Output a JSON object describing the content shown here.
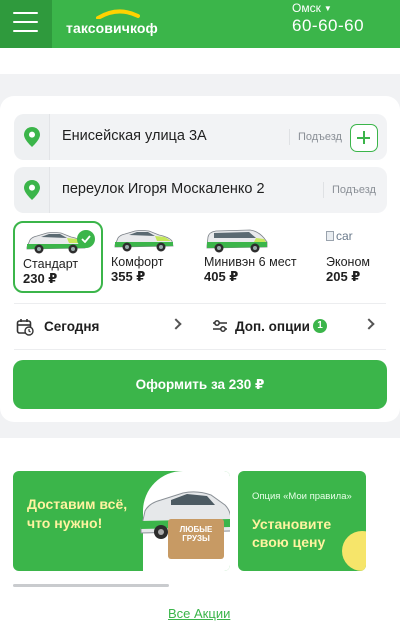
{
  "header": {
    "logo_text": "таксовичкоф",
    "city": "Омск",
    "phone": "60-60-60"
  },
  "route": {
    "from": {
      "address": "Енисейская улица 3А",
      "entrance_placeholder": "Подъезд"
    },
    "to": {
      "address": "переулок Игоря Москаленко 2",
      "entrance_placeholder": "Подъезд"
    }
  },
  "tariffs": [
    {
      "name": "Стандарт",
      "price": "230 ₽",
      "selected": true
    },
    {
      "name": "Комфорт",
      "price": "355 ₽",
      "selected": false
    },
    {
      "name": "Минивэн 6 мест",
      "price": "405 ₽",
      "selected": false
    },
    {
      "name": "Эконом",
      "price": "205 ₽",
      "selected": false,
      "image_alt": "car"
    }
  ],
  "options": {
    "date_label": "Сегодня",
    "extra_label": "Доп. опции",
    "extra_count": "1"
  },
  "order_button": "Оформить за 230 ₽",
  "promos": {
    "banner1": {
      "line1": "Доставим всё,",
      "line2": "что нужно!",
      "box_label": "ЛЮБЫЕ ГРУЗЫ"
    },
    "banner2": {
      "subtitle": "Опция «Мои правила»",
      "line1": "Установите",
      "line2": "свою цену"
    },
    "all_link": "Все Акции"
  },
  "colors": {
    "brand_green": "#3bb54a",
    "dark_green": "#2f9a3d",
    "promo_yellow": "#fff3a0"
  }
}
